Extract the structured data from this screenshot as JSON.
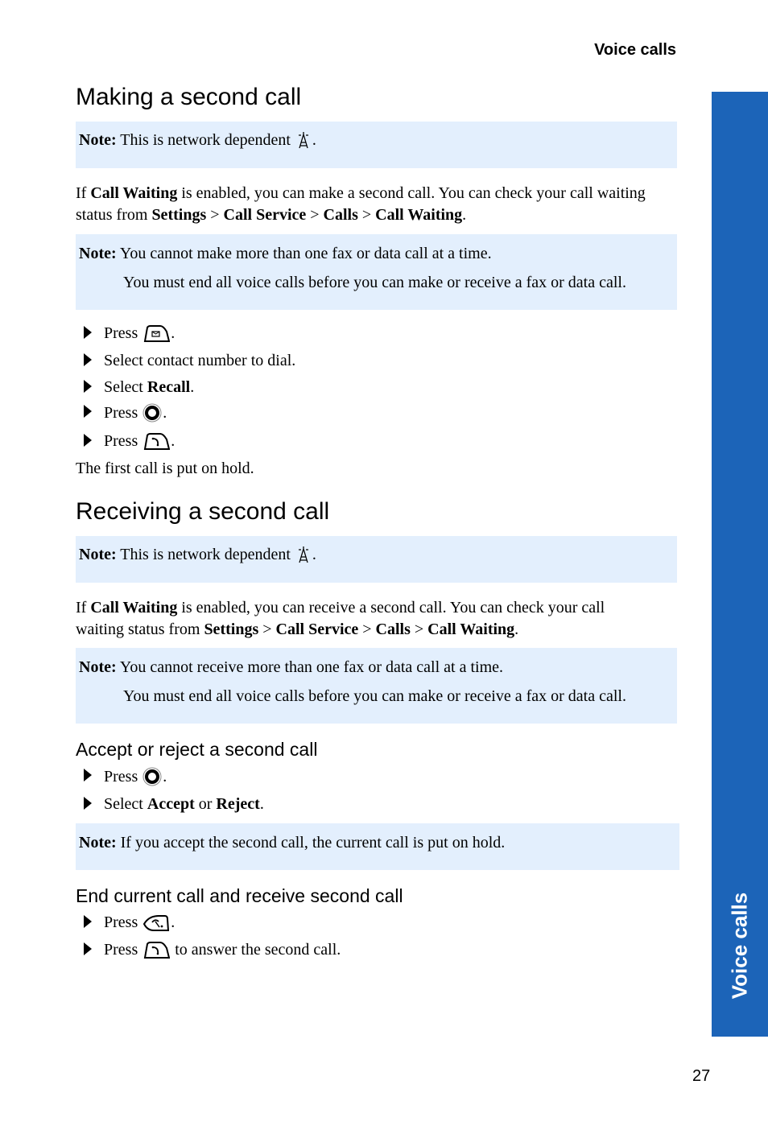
{
  "header": {
    "running_title": "Voice calls"
  },
  "side_tab": {
    "label": "Voice calls",
    "color": "#1c64b8"
  },
  "page_number": "27",
  "note_bg": "#e3effd",
  "section1": {
    "title": "Making a second call",
    "note_network": {
      "label": "Note:",
      "text": "This is network dependent",
      "icon": "network-antenna-icon",
      "end": "."
    },
    "intro": {
      "p1": "If ",
      "b1": "Call Waiting",
      "p2": " is enabled, you can make a second call. You can check your call waiting status from ",
      "b2": "Settings",
      "s1": " > ",
      "b3": "Call Service",
      "s2": " > ",
      "b4": "Calls",
      "s3": " > ",
      "b5": "Call Waiting",
      "p3": "."
    },
    "note_fax": {
      "label": "Note:",
      "line1": "You cannot make more than one fax or data call at a time.",
      "line2": "You must end all voice calls before you can make or receive a fax or data call."
    },
    "steps": [
      {
        "pre": "Press",
        "icon": "messages-key-icon",
        "post": "."
      },
      {
        "pre": "Select contact number to dial.",
        "post": ""
      },
      {
        "pre": "Select ",
        "bold": "Recall",
        "post": "."
      },
      {
        "pre": "Press",
        "icon": "navigation-key-icon",
        "post": "."
      },
      {
        "pre": "Press",
        "icon": "call-key-icon",
        "post": "."
      }
    ],
    "result": "The first call is put on hold."
  },
  "section2": {
    "title": "Receiving a second call",
    "note_network": {
      "label": "Note:",
      "text": "This is network dependent",
      "icon": "network-antenna-icon",
      "end": "."
    },
    "intro": {
      "p1": "If ",
      "b1": "Call Waiting",
      "p2": " is enabled, you can receive a second call. You can check your call waiting status from ",
      "b2": "Settings",
      "s1": " > ",
      "b3": "Call Service",
      "s2": " > ",
      "b4": "Calls",
      "s3": " > ",
      "b5": "Call Waiting",
      "p3": "."
    },
    "note_fax": {
      "label": "Note:",
      "line1": "You cannot receive more than one fax or data call at a time.",
      "line2": "You must end all voice calls before you can make or receive a fax or data call."
    },
    "sub1": {
      "title": "Accept or reject a second call",
      "steps": [
        {
          "pre": "Press",
          "icon": "navigation-key-icon",
          "post": "."
        },
        {
          "pre": "Select ",
          "bold1": "Accept",
          "mid": " or ",
          "bold2": "Reject",
          "post": "."
        }
      ],
      "note": {
        "label": "Note:",
        "text": "If you accept the second call, the current call is put on hold."
      }
    },
    "sub2": {
      "title": "End current call and receive second call",
      "steps": [
        {
          "pre": "Press",
          "icon": "end-call-key-icon",
          "post": "."
        },
        {
          "pre": "Press",
          "icon": "call-key-icon",
          "post": " to answer the second call."
        }
      ]
    }
  }
}
